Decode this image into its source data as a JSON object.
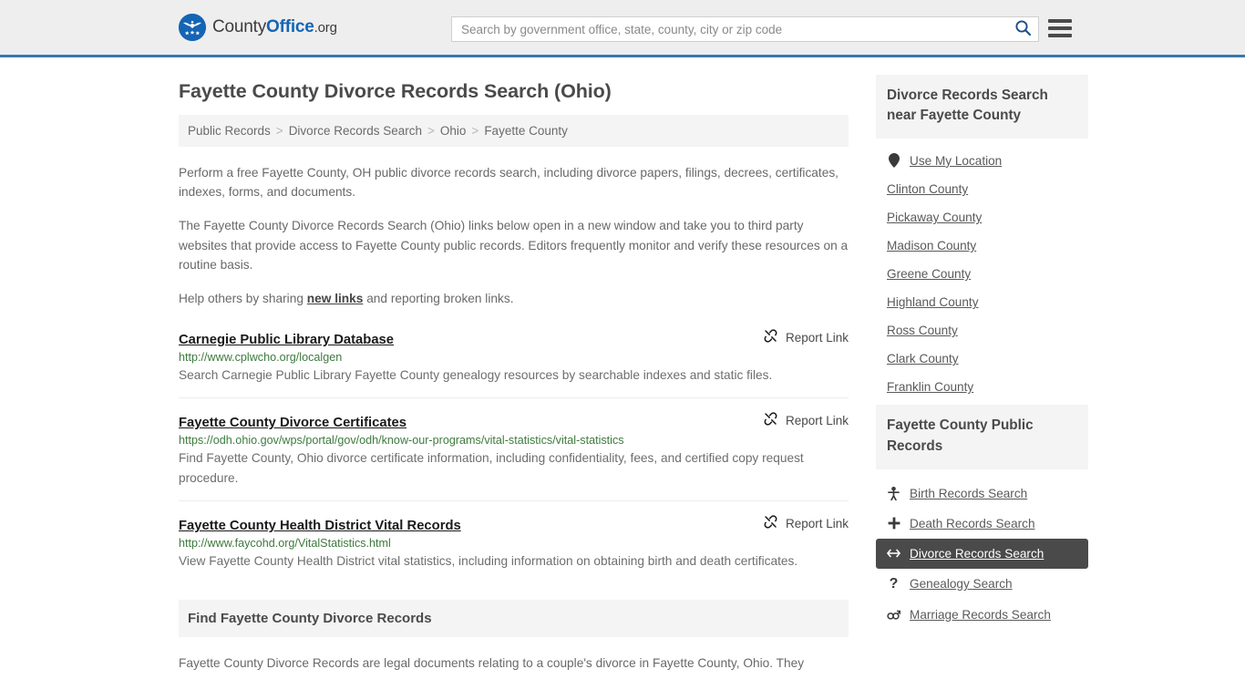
{
  "header": {
    "logo": {
      "part1": "County",
      "part2": "Office",
      "part3": ".org",
      "icon": "eagle-seal-icon"
    },
    "search": {
      "placeholder": "Search by government office, state, county, city or zip code",
      "value": ""
    },
    "search_icon": "search-icon",
    "menu_icon": "hamburger-menu-icon"
  },
  "page_title": "Fayette County Divorce Records Search (Ohio)",
  "breadcrumb": {
    "items": [
      "Public Records",
      "Divorce Records Search",
      "Ohio",
      "Fayette County"
    ],
    "separator": ">"
  },
  "intro": {
    "p1": "Perform a free Fayette County, OH public divorce records search, including divorce papers, filings, decrees, certificates, indexes, forms, and documents.",
    "p2": "The Fayette County Divorce Records Search (Ohio) links below open in a new window and take you to third party websites that provide access to Fayette County public records. Editors frequently monitor and verify these resources on a routine basis.",
    "p3_before": "Help others by sharing ",
    "p3_link": "new links",
    "p3_after": " and reporting broken links."
  },
  "report_link_label": "Report Link",
  "report_link_icon": "broken-link-icon",
  "results": [
    {
      "title": "Carnegie Public Library Database",
      "url": "http://www.cplwcho.org/localgen",
      "description": "Search Carnegie Public Library Fayette County genealogy resources by searchable indexes and static files."
    },
    {
      "title": "Fayette County Divorce Certificates",
      "url": "https://odh.ohio.gov/wps/portal/gov/odh/know-our-programs/vital-statistics/vital-statistics",
      "description": "Find Fayette County, Ohio divorce certificate information, including confidentiality, fees, and certified copy request procedure."
    },
    {
      "title": "Fayette County Health District Vital Records",
      "url": "http://www.faycohd.org/VitalStatistics.html",
      "description": "View Fayette County Health District vital statistics, including information on obtaining birth and death certificates."
    }
  ],
  "bottom_section": {
    "heading": "Find Fayette County Divorce Records",
    "paragraph": "Fayette County Divorce Records are legal documents relating to a couple's divorce in Fayette County, Ohio. They"
  },
  "sidebar": {
    "nearby": {
      "heading": "Divorce Records Search near Fayette County",
      "items": [
        {
          "label": "Use My Location",
          "icon": "map-pin-icon",
          "has_icon": true
        },
        {
          "label": "Clinton County",
          "icon": "",
          "has_icon": false
        },
        {
          "label": "Pickaway County",
          "icon": "",
          "has_icon": false
        },
        {
          "label": "Madison County",
          "icon": "",
          "has_icon": false
        },
        {
          "label": "Greene County",
          "icon": "",
          "has_icon": false
        },
        {
          "label": "Highland County",
          "icon": "",
          "has_icon": false
        },
        {
          "label": "Ross County",
          "icon": "",
          "has_icon": false
        },
        {
          "label": "Clark County",
          "icon": "",
          "has_icon": false
        },
        {
          "label": "Franklin County",
          "icon": "",
          "has_icon": false
        }
      ]
    },
    "public_records": {
      "heading": "Fayette County Public Records",
      "items": [
        {
          "label": "Birth Records Search",
          "icon": "baby-icon",
          "glyph": "Ɔ",
          "active": false
        },
        {
          "label": "Death Records Search",
          "icon": "cross-icon",
          "glyph": "✚",
          "active": false
        },
        {
          "label": "Divorce Records Search",
          "icon": "split-arrows-icon",
          "glyph": "↔",
          "active": true
        },
        {
          "label": "Genealogy Search",
          "icon": "question-mark-icon",
          "glyph": "?",
          "active": false
        },
        {
          "label": "Marriage Records Search",
          "icon": "male-female-icon",
          "glyph": "⚥",
          "active": false
        }
      ]
    }
  },
  "colors": {
    "header_bg": "#eeeeee",
    "header_rule": "#3b77ae",
    "brand_blue": "#1565b5",
    "url_green": "#3d7a3d",
    "active_bg": "#4a4a4a",
    "panel_gray": "#f4f4f4"
  }
}
